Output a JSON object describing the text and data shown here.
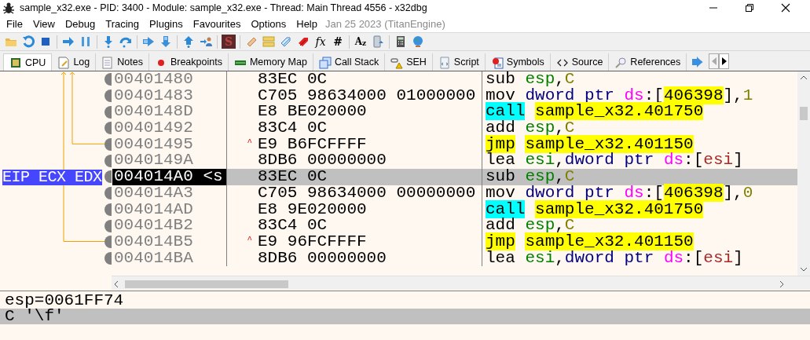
{
  "window": {
    "title": "sample_x32.exe - PID: 3400 - Module: sample_x32.exe - Thread: Main Thread 4556 - x32dbg"
  },
  "menu": [
    "File",
    "View",
    "Debug",
    "Tracing",
    "Plugins",
    "Favourites",
    "Options",
    "Help"
  ],
  "build_info": "Jan 25 2023 (TitanEngine)",
  "toolbar_glyphs": [
    "S",
    "fx",
    "#",
    "A$_{z}$"
  ],
  "tabs": [
    {
      "label": "CPU",
      "selected": true
    },
    {
      "label": "Log",
      "selected": false
    },
    {
      "label": "Notes",
      "selected": false
    },
    {
      "label": "Breakpoints",
      "selected": false
    },
    {
      "label": "Memory Map",
      "selected": false
    },
    {
      "label": "Call Stack",
      "selected": false
    },
    {
      "label": "SEH",
      "selected": false
    },
    {
      "label": "Script",
      "selected": false
    },
    {
      "label": "Symbols",
      "selected": false
    },
    {
      "label": "Source",
      "selected": false
    },
    {
      "label": "References",
      "selected": false
    }
  ],
  "disassembly": {
    "rows": [
      {
        "address": "00401480",
        "bytes": "83EC 0C",
        "selected": false,
        "jump_line": false,
        "instruction": [
          {
            "kind": "mnemonic",
            "text": "sub"
          },
          {
            "kind": "register",
            "text": "esp"
          },
          {
            "kind": "plain",
            "text": ","
          },
          {
            "kind": "number",
            "text": "C"
          }
        ]
      },
      {
        "address": "00401483",
        "bytes": "C705 98634000 01000000",
        "selected": false,
        "jump_line": false,
        "instruction": [
          {
            "kind": "mnemonic",
            "text": "mov"
          },
          {
            "kind": "size",
            "text": "dword ptr"
          },
          {
            "kind": "segment",
            "text": "ds"
          },
          {
            "kind": "plain",
            "text": ":["
          },
          {
            "kind": "symbol",
            "text": "406398"
          },
          {
            "kind": "plain",
            "text": "],"
          },
          {
            "kind": "number",
            "text": "1"
          }
        ]
      },
      {
        "address": "0040148D",
        "bytes": "E8 BE020000",
        "selected": false,
        "jump_line": false,
        "instruction": [
          {
            "kind": "call",
            "text": "call"
          },
          {
            "kind": "symbol",
            "text": "sample_x32.401750"
          }
        ]
      },
      {
        "address": "00401492",
        "bytes": "83C4 0C",
        "selected": false,
        "jump_line": false,
        "instruction": [
          {
            "kind": "mnemonic",
            "text": "add"
          },
          {
            "kind": "register",
            "text": "esp"
          },
          {
            "kind": "plain",
            "text": ","
          },
          {
            "kind": "number",
            "text": "C"
          }
        ]
      },
      {
        "address": "00401495",
        "jump_mark": "^",
        "bytes": "E9 B6FCFFFF",
        "selected": false,
        "jump_line": true,
        "instruction": [
          {
            "kind": "jmp",
            "text": "jmp"
          },
          {
            "kind": "symbol",
            "text": "sample_x32.401150"
          }
        ]
      },
      {
        "address": "0040149A",
        "bytes": "8DB6 00000000",
        "selected": false,
        "jump_line": false,
        "instruction": [
          {
            "kind": "mnemonic",
            "text": "lea"
          },
          {
            "kind": "register",
            "text": "esi"
          },
          {
            "kind": "plain",
            "text": ","
          },
          {
            "kind": "size",
            "text": "dword ptr"
          },
          {
            "kind": "segment",
            "text": "ds"
          },
          {
            "kind": "plain",
            "text": ":["
          },
          {
            "kind": "memreg",
            "text": "esi"
          },
          {
            "kind": "plain",
            "text": "]"
          }
        ]
      },
      {
        "address": "004014A0 <s",
        "gutter_label": "EIP ECX EDX",
        "bytes": "83EC 0C",
        "selected": true,
        "jump_line": false,
        "instruction": [
          {
            "kind": "mnemonic",
            "text": "sub"
          },
          {
            "kind": "register",
            "text": "esp"
          },
          {
            "kind": "plain",
            "text": ","
          },
          {
            "kind": "number",
            "text": "C"
          }
        ]
      },
      {
        "address": "004014A3",
        "bytes": "C705 98634000 00000000",
        "selected": false,
        "jump_line": false,
        "instruction": [
          {
            "kind": "mnemonic",
            "text": "mov"
          },
          {
            "kind": "size",
            "text": "dword ptr"
          },
          {
            "kind": "segment",
            "text": "ds"
          },
          {
            "kind": "plain",
            "text": ":["
          },
          {
            "kind": "symbol",
            "text": "406398"
          },
          {
            "kind": "plain",
            "text": "],"
          },
          {
            "kind": "number",
            "text": "0"
          }
        ]
      },
      {
        "address": "004014AD",
        "bytes": "E8 9E020000",
        "selected": false,
        "jump_line": false,
        "instruction": [
          {
            "kind": "call",
            "text": "call"
          },
          {
            "kind": "symbol",
            "text": "sample_x32.401750"
          }
        ]
      },
      {
        "address": "004014B2",
        "bytes": "83C4 0C",
        "selected": false,
        "jump_line": false,
        "instruction": [
          {
            "kind": "mnemonic",
            "text": "add"
          },
          {
            "kind": "register",
            "text": "esp"
          },
          {
            "kind": "plain",
            "text": ","
          },
          {
            "kind": "number",
            "text": "C"
          }
        ]
      },
      {
        "address": "004014B5",
        "jump_mark": "^",
        "bytes": "E9 96FCFFFF",
        "selected": false,
        "jump_line": true,
        "instruction": [
          {
            "kind": "jmp",
            "text": "jmp"
          },
          {
            "kind": "symbol",
            "text": "sample_x32.401150"
          }
        ]
      },
      {
        "address": "004014BA",
        "bytes": "8DB6 00000000",
        "selected": false,
        "jump_line": false,
        "instruction": [
          {
            "kind": "mnemonic",
            "text": "lea"
          },
          {
            "kind": "register",
            "text": "esi"
          },
          {
            "kind": "plain",
            "text": ","
          },
          {
            "kind": "size",
            "text": "dword ptr"
          },
          {
            "kind": "segment",
            "text": "ds"
          },
          {
            "kind": "plain",
            "text": ":["
          },
          {
            "kind": "memreg",
            "text": "esi"
          },
          {
            "kind": "plain",
            "text": "]"
          }
        ]
      }
    ]
  },
  "info_pane": {
    "lines": [
      {
        "text": "esp=0061FF74",
        "selected": false
      },
      {
        "text": "C '\\f'",
        "selected": true
      }
    ]
  }
}
